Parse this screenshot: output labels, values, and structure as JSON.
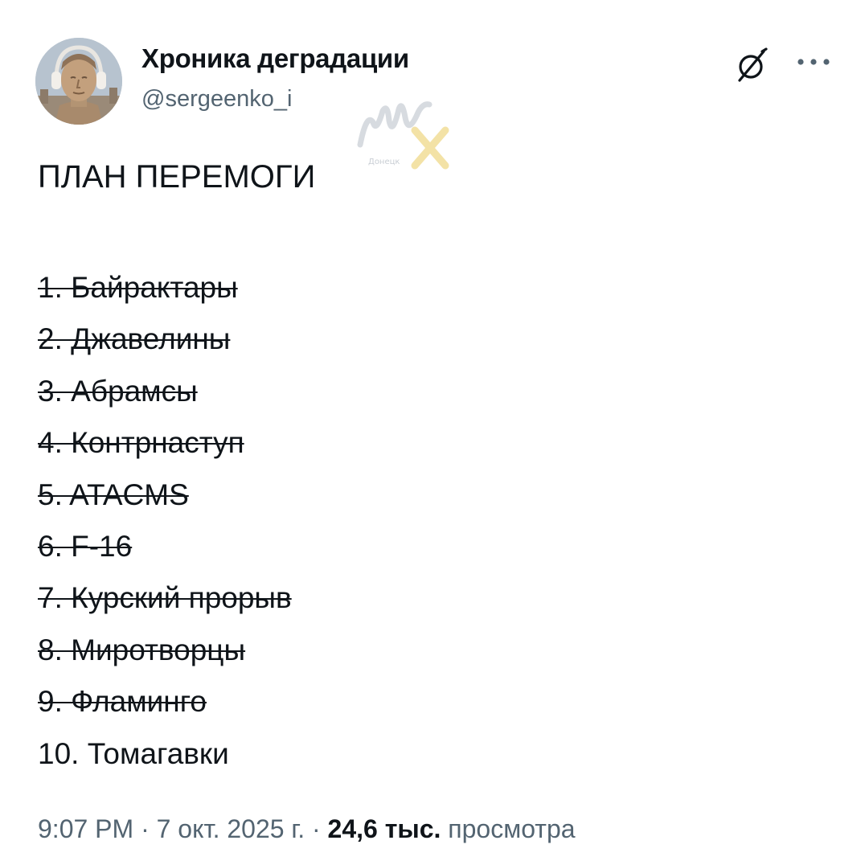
{
  "author": {
    "display_name": "Хроника деградации",
    "handle": "@sergeenko_i",
    "avatar_icon": "avatar-helmet-headphones-icon"
  },
  "header_actions": {
    "grok_icon": "slashed-circle-icon",
    "more_icon": "more-dots-icon"
  },
  "watermark": {
    "text": "Донецк"
  },
  "tweet": {
    "title": "ПЛАН ПЕРЕМОГИ",
    "items": [
      {
        "text": "1. Байрактары",
        "struck": true
      },
      {
        "text": "2. Джавелины",
        "struck": true
      },
      {
        "text": "3. Абрамсы",
        "struck": true
      },
      {
        "text": "4. Контрнаступ",
        "struck": true
      },
      {
        "text": "5. ATACMS",
        "struck": true
      },
      {
        "text": "6. F-16",
        "struck": true
      },
      {
        "text": "7. Курский прорыв",
        "struck": true
      },
      {
        "text": "8. Миротворцы",
        "struck": true
      },
      {
        "text": "9. Фламинго",
        "struck": true
      },
      {
        "text": "10. Томагавки",
        "struck": false
      }
    ]
  },
  "meta": {
    "time": "9:07 PM",
    "separator": " · ",
    "date": "7 окт. 2025 г.",
    "views_count": "24,6 тыс.",
    "views_label": "просмотра"
  },
  "colors": {
    "text": "#0f1419",
    "secondary": "#536471"
  }
}
